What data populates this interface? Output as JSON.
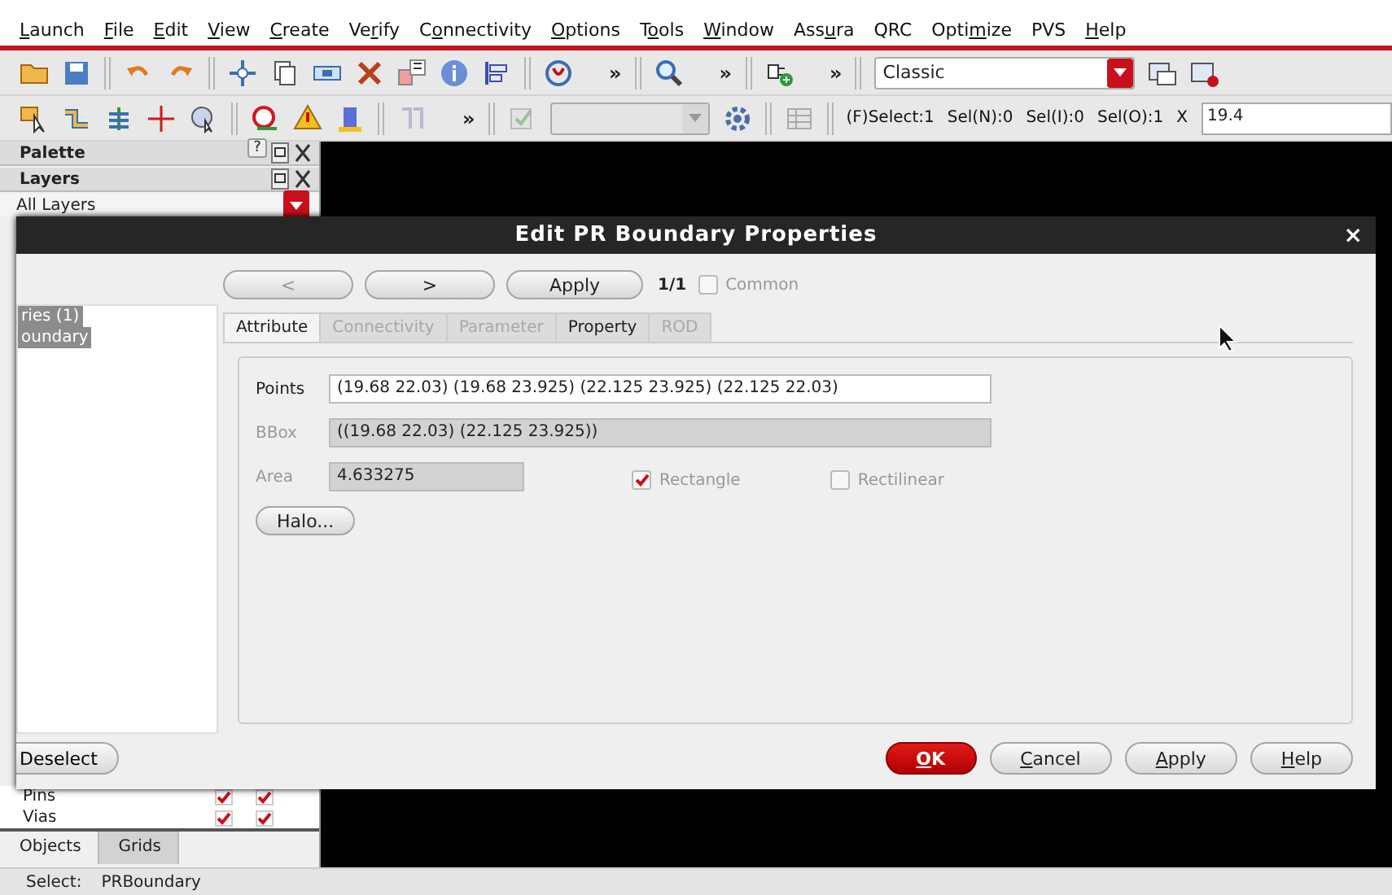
{
  "menu": [
    {
      "key": "L",
      "after": "aunch"
    },
    {
      "key": "F",
      "after": "ile"
    },
    {
      "key": "E",
      "after": "dit"
    },
    {
      "key": "V",
      "after": "iew"
    },
    {
      "key": "C",
      "after": "reate"
    },
    {
      "before": "Ve",
      "key": "r",
      "after": "ify"
    },
    {
      "before": "C",
      "key": "o",
      "after": "nnectivity"
    },
    {
      "key": "O",
      "after": "ptions"
    },
    {
      "before": "T",
      "key": "o",
      "after": "ols"
    },
    {
      "key": "W",
      "after": "indow"
    },
    {
      "before": "Ass",
      "key": "u",
      "after": "ra"
    },
    {
      "before": "QRC"
    },
    {
      "before": "Opti",
      "key": "m",
      "after": "ize"
    },
    {
      "before": "PVS"
    },
    {
      "key": "H",
      "after": "elp"
    }
  ],
  "toolbar1": {
    "chevrons": [
      "»",
      "»",
      "»"
    ],
    "workspace": "Classic"
  },
  "toolbar2": {
    "chevron": "»",
    "status": [
      "(F)Select:1",
      "Sel(N):0",
      "Sel(I):0",
      "Sel(O):1"
    ],
    "coord_label": "X",
    "coord_value": "19.4"
  },
  "dock": {
    "palette_title": "Palette",
    "help": "?",
    "layers_title": "Layers",
    "filter": "All Layers",
    "layers": [
      {
        "name": "Pins",
        "visible": true,
        "selectable": true
      },
      {
        "name": "Vias",
        "visible": true,
        "selectable": true
      }
    ],
    "tabs": [
      {
        "label": "Objects",
        "selected": true
      },
      {
        "label": "Grids",
        "selected": false
      }
    ]
  },
  "dialog": {
    "title": "Edit PR Boundary Properties",
    "close": "×",
    "list": [
      {
        "label": "ries (1)",
        "selected": true
      },
      {
        "label": "oundary",
        "selected": true
      }
    ],
    "nav": [
      {
        "label": "<",
        "disabled": true
      },
      {
        "label": ">",
        "disabled": false
      },
      {
        "label": "Apply",
        "disabled": false
      }
    ],
    "counter": "1/1",
    "common": {
      "label": "Common",
      "checked": false
    },
    "tabs": [
      {
        "label": "Attribute",
        "selected": true,
        "disabled": false
      },
      {
        "label": "Connectivity",
        "selected": false,
        "disabled": true
      },
      {
        "label": "Parameter",
        "selected": false,
        "disabled": true
      },
      {
        "label": "Property",
        "selected": false,
        "disabled": false
      },
      {
        "label": "ROD",
        "selected": false,
        "disabled": true
      }
    ],
    "fields": [
      {
        "label": "Points",
        "value": "(19.68 22.03) (19.68 23.925) (22.125 23.925) (22.125 22.03)",
        "editable": true,
        "kind": "wide"
      },
      {
        "label": "BBox",
        "value": "((19.68 22.03) (22.125 23.925))",
        "editable": false,
        "kind": "wide"
      },
      {
        "label": "Area",
        "value": "4.633275",
        "editable": false,
        "kind": "short"
      }
    ],
    "checks": [
      {
        "label": "Rectangle",
        "checked": true
      },
      {
        "label": "Rectilinear",
        "checked": false
      }
    ],
    "halo": "Halo...",
    "deselect": "Deselect",
    "buttons": [
      {
        "key": "O",
        "after": "K",
        "kind": "primary"
      },
      {
        "key": "C",
        "after": "ancel",
        "kind": "normal"
      },
      {
        "key": "A",
        "after": "pply",
        "kind": "normal"
      },
      {
        "key": "H",
        "after": "elp",
        "kind": "normal"
      }
    ]
  },
  "status_bar": {
    "label": "Select:",
    "value": "PRBoundary"
  }
}
